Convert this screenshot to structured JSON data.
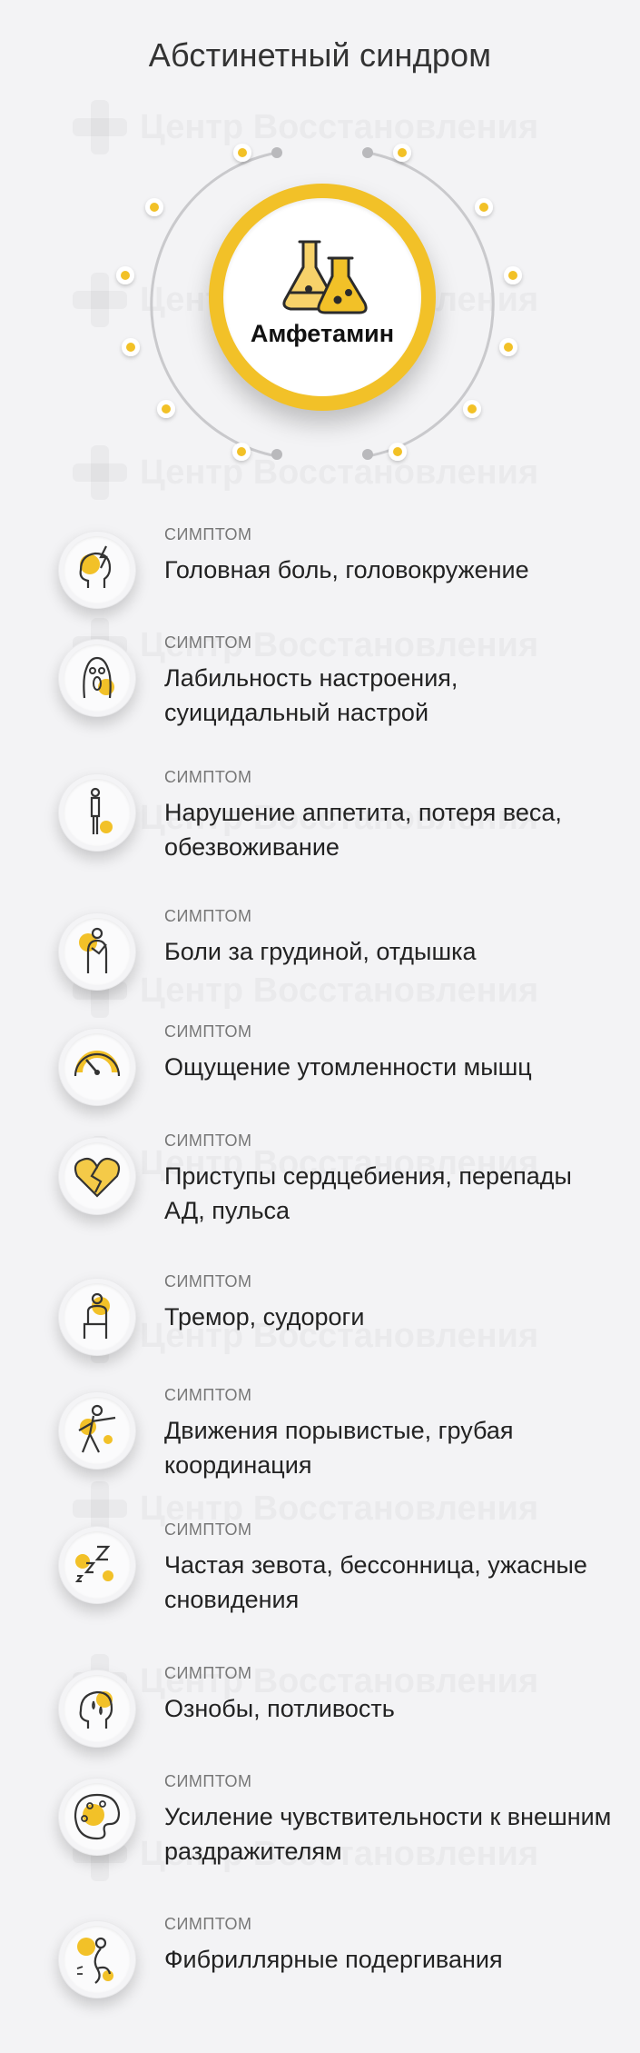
{
  "title": "Абстинетный синдром",
  "watermark": "Центр Восстановления",
  "drug": {
    "name": "Амфетамин",
    "icon": "flasks-icon"
  },
  "colors": {
    "accent": "#f2c128",
    "background": "#f3f3f5",
    "text": "#222222",
    "muted": "#777777",
    "ring": "#cccccc"
  },
  "symptom_label": "СИМПТОМ",
  "symptoms": [
    {
      "icon": "headache-icon",
      "text": "Головная боль, головокружение"
    },
    {
      "icon": "scream-face-icon",
      "text": "Лабильность настроения, суицидальный настрой"
    },
    {
      "icon": "thin-person-icon",
      "text": "Нарушение аппетита, потеря веса, обезвоживание"
    },
    {
      "icon": "chest-pain-icon",
      "text": "Боли за грудиной, отдышка"
    },
    {
      "icon": "gauge-icon",
      "text": "Ощущение утомленности мышц"
    },
    {
      "icon": "broken-heart-icon",
      "text": "Приступы сердцебиения, перепады АД, пульса"
    },
    {
      "icon": "trembling-person-icon",
      "text": "Тремор, судороги"
    },
    {
      "icon": "stumbling-person-icon",
      "text": "Движения порывистые, грубая координация"
    },
    {
      "icon": "sleep-zzz-icon",
      "text": "Частая зевота, бессонница, ужасные сновидения"
    },
    {
      "icon": "sweating-head-icon",
      "text": "Ознобы, потливость"
    },
    {
      "icon": "palette-icon",
      "text": "Усиление чувствительности к внешним раздражителям"
    },
    {
      "icon": "twitching-body-icon",
      "text": "Фибриллярные подергивания"
    }
  ]
}
